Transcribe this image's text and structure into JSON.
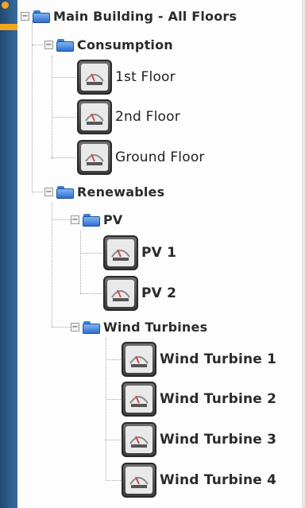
{
  "tree": {
    "root": {
      "label": "Main Building - All Floors",
      "expander": "−"
    },
    "consumption": {
      "label": "Consumption",
      "expander": "−",
      "items": [
        "1st Floor",
        "2nd Floor",
        "Ground Floor"
      ]
    },
    "renewables": {
      "label": "Renewables",
      "expander": "−",
      "pv": {
        "label": "PV",
        "expander": "−",
        "items": [
          "PV 1",
          "PV 2"
        ]
      },
      "wind": {
        "label": "Wind Turbines",
        "expander": "−",
        "items": [
          "Wind Turbine 1",
          "Wind Turbine 2",
          "Wind Turbine 3",
          "Wind Turbine 4"
        ]
      }
    }
  },
  "icons": {
    "folder": "folder-icon",
    "meter": "meter-device-icon",
    "expander": "collapse-icon"
  },
  "colors": {
    "sidebar": "#2f5f8f",
    "accent": "#f4a61c",
    "folder": "#2d6fd0",
    "text": "#2b2b2b"
  }
}
